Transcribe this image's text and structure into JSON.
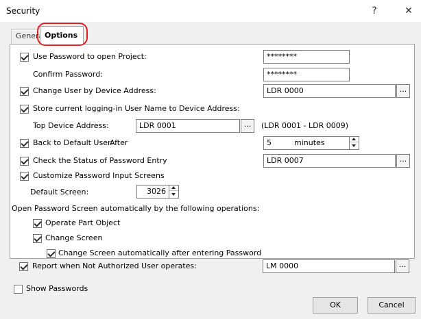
{
  "window": {
    "title": "Security",
    "help_glyph": "?",
    "close_glyph": "✕"
  },
  "tabs": [
    {
      "label": "General"
    },
    {
      "label": "Options"
    }
  ],
  "options": {
    "use_password": {
      "label": "Use Password to open Project:",
      "checked": true,
      "value": "********"
    },
    "confirm_password": {
      "label": "Confirm Password:",
      "value": "********"
    },
    "change_user": {
      "label": "Change User by Device Address:",
      "checked": true,
      "value": "LDR 0000"
    },
    "store_user_name": {
      "label": "Store current logging-in User Name to Device Address:",
      "checked": true
    },
    "top_device_address": {
      "label": "Top Device Address:",
      "value": "LDR 0001",
      "range": "(LDR 0001 - LDR 0009)"
    },
    "back_to_default": {
      "label": "Back to Default User:",
      "checked": true,
      "after_label": "After",
      "value": "5",
      "unit": "minutes"
    },
    "check_status": {
      "label": "Check the Status of Password Entry",
      "checked": true,
      "value": "LDR 0007"
    },
    "customize_screens": {
      "label": "Customize Password Input Screens",
      "checked": true
    },
    "default_screen": {
      "label": "Default Screen:",
      "value": "3026"
    },
    "open_auto_label": "Open Password Screen automatically by the following operations:",
    "operate_part": {
      "label": "Operate Part Object",
      "checked": true
    },
    "change_screen": {
      "label": "Change Screen",
      "checked": true
    },
    "change_screen_auto": {
      "label": "Change Screen automatically after entering Password",
      "checked": true
    },
    "report_unauthorized": {
      "label": "Report when Not Authorized User operates:",
      "checked": true,
      "value": "LM 0000"
    },
    "browse_label": "..."
  },
  "footer": {
    "show_passwords": {
      "label": "Show Passwords",
      "checked": false
    },
    "ok_label": "OK",
    "cancel_label": "Cancel"
  }
}
